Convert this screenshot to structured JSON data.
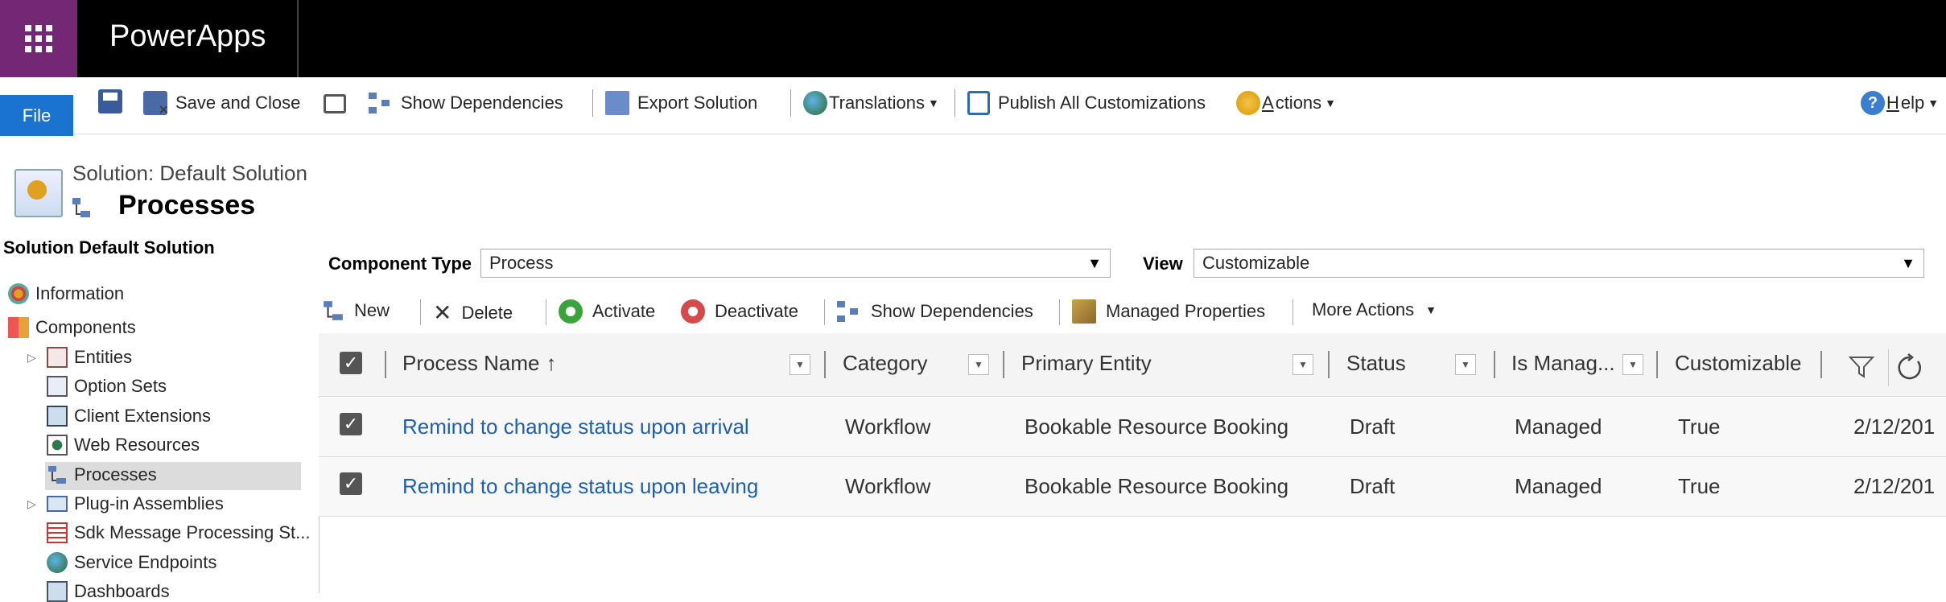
{
  "app": {
    "name": "PowerApps"
  },
  "ribbon": {
    "file": "File",
    "save_and_close": "Save and Close",
    "show_dependencies": "Show Dependencies",
    "export_solution": "Export Solution",
    "translations": "Translations",
    "publish_all": "Publish All Customizations",
    "actions_prefix": "A",
    "actions_rest": "ctions",
    "help_prefix": "H",
    "help_rest": "elp"
  },
  "header": {
    "solution_label": "Solution: Default Solution",
    "page_title": "Processes"
  },
  "sidebar": {
    "title": "Solution Default Solution",
    "items": [
      {
        "label": "Information"
      },
      {
        "label": "Components"
      },
      {
        "label": "Entities"
      },
      {
        "label": "Option Sets"
      },
      {
        "label": "Client Extensions"
      },
      {
        "label": "Web Resources"
      },
      {
        "label": "Processes"
      },
      {
        "label": "Plug-in Assemblies"
      },
      {
        "label": "Sdk Message Processing St..."
      },
      {
        "label": "Service Endpoints"
      },
      {
        "label": "Dashboards"
      }
    ]
  },
  "filters": {
    "component_type_label": "Component Type",
    "component_type_value": "Process",
    "view_label": "View",
    "view_value": "Customizable"
  },
  "grid_commands": {
    "new": "New",
    "delete": "Delete",
    "activate": "Activate",
    "deactivate": "Deactivate",
    "show_dependencies": "Show Dependencies",
    "managed_properties": "Managed Properties",
    "more_actions": "More Actions"
  },
  "grid": {
    "columns": {
      "process_name": "Process Name",
      "category": "Category",
      "primary_entity": "Primary Entity",
      "status": "Status",
      "is_managed": "Is Manag...",
      "customizable": "Customizable"
    },
    "rows": [
      {
        "process_name": "Remind to change status upon arrival",
        "category": "Workflow",
        "primary_entity": "Bookable Resource Booking",
        "status": "Draft",
        "is_managed": "Managed",
        "customizable": "True",
        "date": "2/12/201"
      },
      {
        "process_name": "Remind to change status upon leaving",
        "category": "Workflow",
        "primary_entity": "Bookable Resource Booking",
        "status": "Draft",
        "is_managed": "Managed",
        "customizable": "True",
        "date": "2/12/201"
      }
    ]
  },
  "colors": {
    "waffle_bg": "#742774",
    "topbar_bg": "#000000",
    "file_button": "#1a73cf",
    "link": "#1e5fb0"
  }
}
